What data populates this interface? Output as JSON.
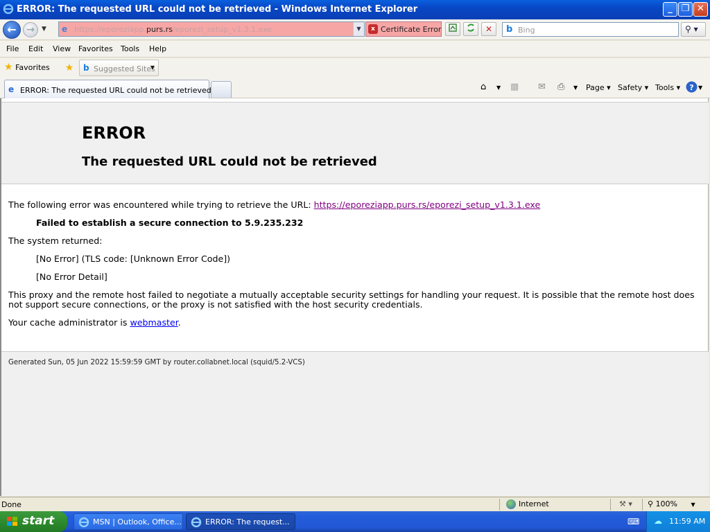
{
  "window": {
    "title": "ERROR: The requested URL could not be retrieved - Windows Internet Explorer",
    "minimize": "_",
    "maximize": "❐",
    "close": "✕"
  },
  "navigation": {
    "url_prefix": "https://eporeziapp.",
    "url_domain": "purs.rs",
    "url_suffix": "/eporezi_setup_v1.3.1.exe",
    "cert_error": "Certificate Error",
    "search_placeholder": "Bing"
  },
  "menu": [
    "File",
    "Edit",
    "View",
    "Favorites",
    "Tools",
    "Help"
  ],
  "favorites": {
    "label": "Favorites",
    "suggested_sites": "Suggested Sites"
  },
  "tab": {
    "title": "ERROR: The requested URL could not be retrieved"
  },
  "command_bar": {
    "page": "Page",
    "safety": "Safety",
    "tools": "Tools"
  },
  "page": {
    "heading": "ERROR",
    "subheading": "The requested URL could not be retrieved",
    "intro": "The following error was encountered while trying to retrieve the URL: ",
    "url_link": "https://eporeziapp.purs.rs/eporezi_setup_v1.3.1.exe",
    "failure": "Failed to establish a secure connection to 5.9.235.232",
    "system_returned": "The system returned:",
    "tls_code": "[No Error] (TLS code: [Unknown Error Code])",
    "error_detail": "[No Error Detail]",
    "explanation_line1": "This proxy and the remote host failed to negotiate a mutually acceptable security settings for handling your request. It is possible that the remote host does",
    "explanation_line2": "not support secure connections, or the proxy is not satisfied with the host security credentials.",
    "cache_admin_prefix": "Your cache administrator is ",
    "cache_admin_link": "webmaster",
    "cache_admin_suffix": ".",
    "generated": "Generated Sun, 05 Jun 2022 15:59:59 GMT by router.collabnet.local (squid/5.2-VCS)"
  },
  "status": {
    "text": "Done",
    "zone": "Internet",
    "zoom": "100%"
  },
  "taskbar": {
    "start": "start",
    "tasks": [
      "MSN | Outlook, Office...",
      "ERROR: The request..."
    ],
    "clock": "11:59 AM"
  }
}
